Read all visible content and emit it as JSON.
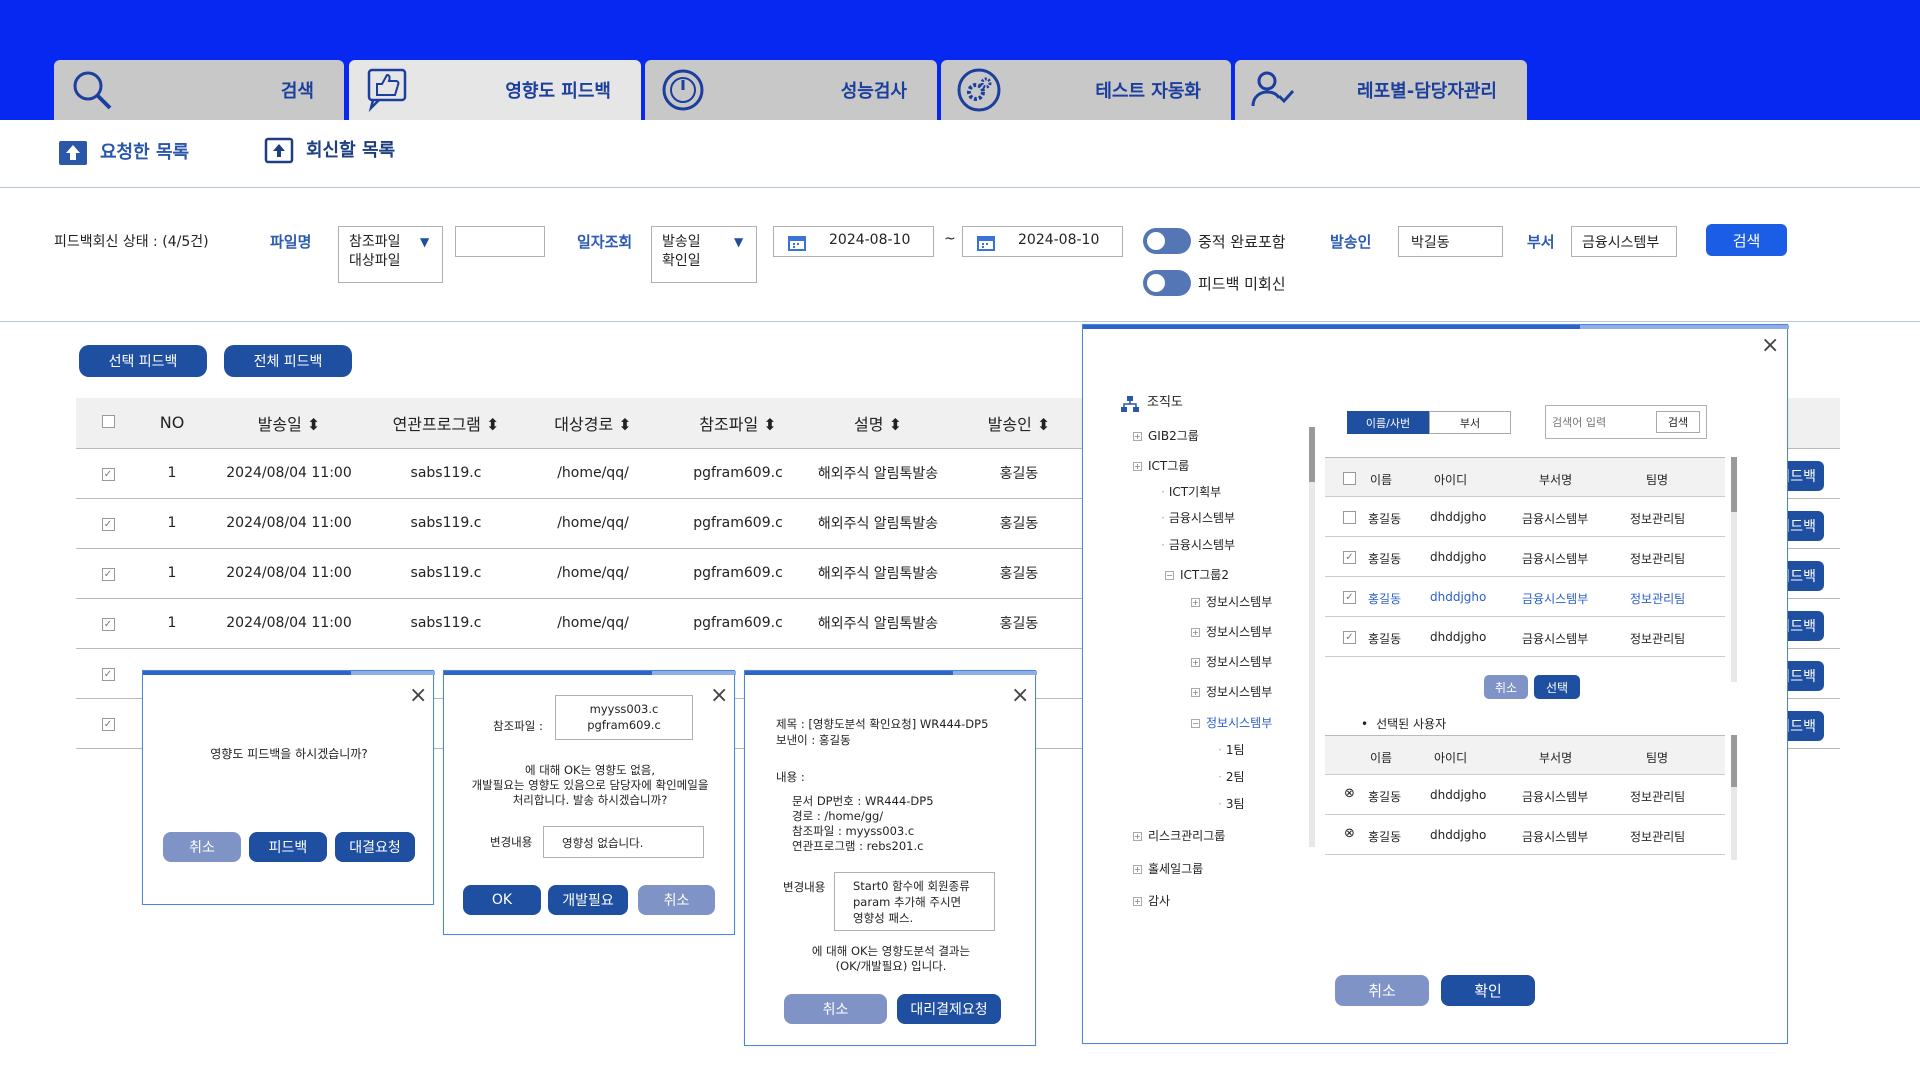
{
  "tabs": [
    {
      "label": "검색",
      "icon": "search-icon"
    },
    {
      "label": "영향도 피드백",
      "icon": "thumbs-up-icon"
    },
    {
      "label": "성능검사",
      "icon": "gauge-icon"
    },
    {
      "label": "테스트 자동화",
      "icon": "gear-icon"
    },
    {
      "label": "레포별-담당자관리",
      "icon": "user-check-icon"
    }
  ],
  "subnav": {
    "requested": "요청한 목록",
    "reply": "회신할 목록"
  },
  "filter": {
    "status": "피드백회신 상태 : (4/5건)",
    "file_label": "파일명",
    "file_options": [
      "참조파일",
      "대상파일"
    ],
    "date_label": "일자조회",
    "date_options": [
      "발송일",
      "확인일"
    ],
    "date_from": "2024-08-10",
    "date_sep": "~",
    "date_to": "2024-08-10",
    "toggle1": "중적 완료포함",
    "toggle2": "피드백 미회신",
    "sender_label": "발송인",
    "sender_value": "박길동",
    "dept_label": "부서",
    "dept_value": "금융시스템부",
    "search_btn": "검색"
  },
  "actions": {
    "select_feedback": "선택 피드백",
    "all_feedback": "전체 피드백"
  },
  "table": {
    "headers": [
      "NO",
      "발송일",
      "연관프로그램",
      "대상경로",
      "참조파일",
      "설명",
      "발송인"
    ],
    "rows": [
      [
        "1",
        "2024/08/04 11:00",
        "sabs119.c",
        "/home/qq/",
        "pgfram609.c",
        "해외주식 알림톡발송",
        "홍길동"
      ],
      [
        "1",
        "2024/08/04 11:00",
        "sabs119.c",
        "/home/qq/",
        "pgfram609.c",
        "해외주식 알림톡발송",
        "홍길동"
      ],
      [
        "1",
        "2024/08/04 11:00",
        "sabs119.c",
        "/home/qq/",
        "pgfram609.c",
        "해외주식 알림톡발송",
        "홍길동"
      ],
      [
        "1",
        "2024/08/04 11:00",
        "sabs119.c",
        "/home/qq/",
        "pgfram609.c",
        "해외주식 알림톡발송",
        "홍길동"
      ]
    ],
    "row_button": "피드백"
  },
  "dialog1": {
    "message": "영향도 피드백을 하시겠습니까?",
    "cancel": "취소",
    "feedback": "피드백",
    "approval": "대결요청"
  },
  "dialog2": {
    "ref_label": "참조파일 :",
    "ref_files": [
      "myyss003.c",
      "pgfram609.c"
    ],
    "msg_lines": [
      "에 대해 OK는 영향도 없음,",
      "개발필요는 영향도 있음으로 담당자에 확인메일을",
      "처리합니다. 발송 하시겠습니까?"
    ],
    "change_label": "변경내용",
    "change_value": "영향성 없습니다.",
    "ok": "OK",
    "dev": "개발필요",
    "cancel": "취소"
  },
  "dialog3": {
    "title": "제목 : [영향도분석 확인요청] WR444-DP5",
    "sender": "보낸이 : 홍길동",
    "content_label": "내용 :",
    "content_lines": [
      "문서 DP번호 : WR444-DP5",
      "경로 : /home/gg/",
      "참조파일 : myyss003.c",
      "연관프로그램 : rebs201.c"
    ],
    "change_label": "변경내용",
    "change_lines": [
      "Start0 함수에 회원종류",
      "param 추가해 주시면",
      "영향성 패스."
    ],
    "footer_lines": [
      "에 대해 OK는 영향도분석 결과는",
      "(OK/개발필요) 입니다."
    ],
    "cancel": "취소",
    "proxy": "대리결제요청"
  },
  "org": {
    "title": "조직도",
    "tree": [
      {
        "label": "GIB2그룹",
        "level": 0,
        "exp": "+"
      },
      {
        "label": "ICT그룹",
        "level": 0,
        "exp": "+"
      },
      {
        "label": "ICT기획부",
        "level": 1,
        "exp": ""
      },
      {
        "label": "금융시스템부",
        "level": 1,
        "exp": ""
      },
      {
        "label": "금융시스템부",
        "level": 1,
        "exp": ""
      },
      {
        "label": "ICT그룹2",
        "level": 1,
        "exp": "-"
      },
      {
        "label": "정보시스템부",
        "level": 2,
        "exp": "+"
      },
      {
        "label": "정보시스템부",
        "level": 2,
        "exp": "+"
      },
      {
        "label": "정보시스템부",
        "level": 2,
        "exp": "+"
      },
      {
        "label": "정보시스템부",
        "level": 2,
        "exp": "+"
      },
      {
        "label": "정보시스템부",
        "level": 2,
        "exp": "-",
        "selected": true
      },
      {
        "label": "1팀",
        "level": 3,
        "exp": ""
      },
      {
        "label": "2팀",
        "level": 3,
        "exp": ""
      },
      {
        "label": "3팀",
        "level": 3,
        "exp": ""
      },
      {
        "label": "리스크관리그룹",
        "level": 0,
        "exp": "+"
      },
      {
        "label": "홀세일그룹",
        "level": 0,
        "exp": "+"
      },
      {
        "label": "감사",
        "level": 0,
        "exp": "+"
      }
    ],
    "tab_name": "이름/사번",
    "tab_dept": "부서",
    "search_placeholder": "검색어 입력",
    "search_btn": "검색",
    "headers": [
      "이름",
      "아이디",
      "부서명",
      "팀명"
    ],
    "users": [
      {
        "name": "홍길동",
        "id": "dhddjgho",
        "dept": "금융시스템부",
        "team": "정보관리팀",
        "checked": false,
        "highlight": false
      },
      {
        "name": "홍길동",
        "id": "dhddjgho",
        "dept": "금융시스템부",
        "team": "정보관리팀",
        "checked": true,
        "highlight": false
      },
      {
        "name": "홍길동",
        "id": "dhddjgho",
        "dept": "금융시스템부",
        "team": "정보관리팀",
        "checked": true,
        "highlight": true
      },
      {
        "name": "홍길동",
        "id": "dhddjgho",
        "dept": "금융시스템부",
        "team": "정보관리팀",
        "checked": true,
        "highlight": false
      }
    ],
    "mid_cancel": "취소",
    "mid_select": "선택",
    "selected_title": "선택된 사용자",
    "selected": [
      {
        "name": "홍길동",
        "id": "dhddjgho",
        "dept": "금융시스템부",
        "team": "정보관리팀"
      },
      {
        "name": "홍길동",
        "id": "dhddjgho",
        "dept": "금융시스템부",
        "team": "정보관리팀"
      }
    ],
    "cancel": "취소",
    "confirm": "확인"
  }
}
